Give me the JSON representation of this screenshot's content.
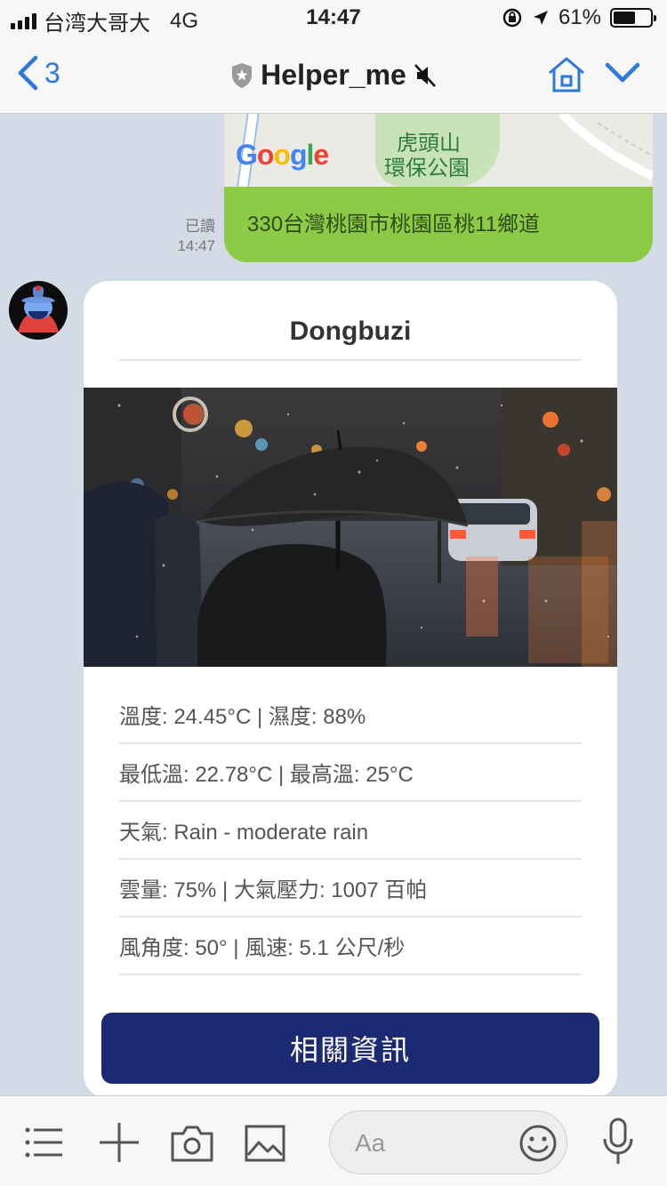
{
  "status": {
    "carrier": "台湾大哥大",
    "network": "4G",
    "time": "14:47",
    "battery": "61%",
    "battery_level": 0.61
  },
  "nav": {
    "back_count": "3",
    "chat_title": "Helper_me"
  },
  "map_message": {
    "logo": "Google",
    "park_name_line1": "虎頭山",
    "park_name_line2": "環保公園",
    "address": "330台灣桃園市桃園區桃11鄉道",
    "read_label": "已讀",
    "read_time": "14:47"
  },
  "card": {
    "title": "Dongbuzi",
    "rows": [
      "溫度: 24.45°C | 濕度: 88%",
      "最低溫: 22.78°C | 最高溫: 25°C",
      "天氣: Rain - moderate rain",
      "雲量: 75% | 大氣壓力: 1007 百帕",
      "風角度: 50° | 風速: 5.1 公尺/秒"
    ],
    "button_label": "相關資訊"
  },
  "toolbar": {
    "input_placeholder": "Aa"
  },
  "colors": {
    "accent_blue": "#2d79d8",
    "bubble_green": "#8ccb45",
    "button_navy": "#1b2a73",
    "chat_bg": "#d3dbe6"
  }
}
